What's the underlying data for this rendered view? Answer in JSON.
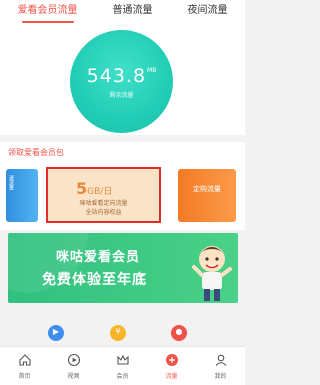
{
  "tabs": [
    {
      "label": "爱看会员流量",
      "active": true
    },
    {
      "label": "普通流量",
      "active": false
    },
    {
      "label": "夜间流量",
      "active": false
    }
  ],
  "gauge": {
    "value": "543.8",
    "unit": "MB",
    "label": "剩余流量",
    "color": "#22cdb5"
  },
  "packages": {
    "title": "领取爱看会员包",
    "left_card_label": "送流量",
    "main_card": {
      "amount": "5",
      "amount_unit": "GB/日",
      "line1": "咪咕爱看定向流量",
      "line2": "全站内容权益"
    },
    "right_card_text": "定购流量",
    "highlight_color": "#e02b2b"
  },
  "banner": {
    "line1": "咪咕爱看会员",
    "line2": "免费体验至年底",
    "color": "#2fc07f"
  },
  "app_icons": [
    {
      "icon": "play-circle-icon",
      "glyph": "▶"
    },
    {
      "icon": "coin-icon",
      "glyph": "¥"
    },
    {
      "icon": "flame-icon",
      "glyph": "●"
    }
  ],
  "bottom_nav": [
    {
      "label": "首页",
      "icon": "home-icon",
      "active": false
    },
    {
      "label": "视频",
      "icon": "play-icon",
      "active": false
    },
    {
      "label": "会员",
      "icon": "crown-icon",
      "active": false
    },
    {
      "label": "流量",
      "icon": "traffic-icon",
      "active": true
    },
    {
      "label": "我的",
      "icon": "user-icon",
      "active": false
    }
  ],
  "accent_color": "#f0534a"
}
